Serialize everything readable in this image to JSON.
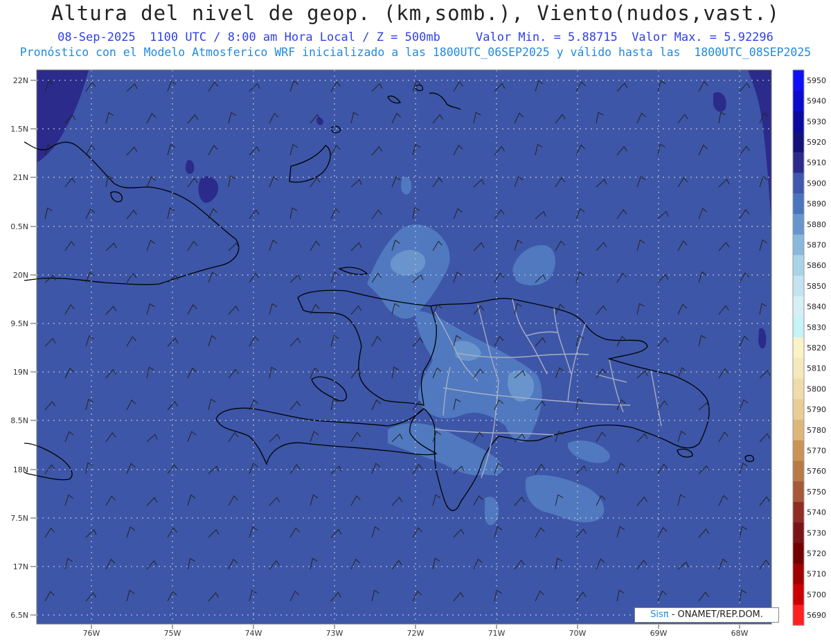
{
  "header": {
    "title": "Altura del nivel de geop. (km,somb.), Viento(nudos,vast.)",
    "date": "08-Sep-2025",
    "time": "1100 UTC / 8:00 am Hora Local / Z = 500mb",
    "valmin": "Valor Min. = 5.88715",
    "valmax": "Valor Max. = 5.92296",
    "model_line": "Pronóstico con el Modelo Atmosferico WRF inicializado a las 1800UTC_06SEP2025 y válido hasta las  1800UTC_08SEP2025"
  },
  "axes": {
    "lat_labels": [
      "22N",
      "1.5N",
      "21N",
      "0.5N",
      "20N",
      "9.5N",
      "19N",
      "8.5N",
      "18N",
      "7.5N",
      "17N",
      "6.5N"
    ],
    "lon_labels": [
      "76W",
      "75W",
      "74W",
      "73W",
      "72W",
      "71W",
      "70W",
      "69W",
      "68W"
    ]
  },
  "colorbar": {
    "labels": [
      "5950",
      "5940",
      "5930",
      "5920",
      "5910",
      "5900",
      "5890",
      "5880",
      "5870",
      "5860",
      "5850",
      "5840",
      "5830",
      "5820",
      "5810",
      "5800",
      "5790",
      "5780",
      "5770",
      "5760",
      "5750",
      "5740",
      "5730",
      "5720",
      "5710",
      "5700",
      "5690"
    ],
    "colors": [
      "#1010f8",
      "#0b0bd0",
      "#0a0aa0",
      "#12127a",
      "#2b2b8c",
      "#3f57ad",
      "#4a74bd",
      "#6696cc",
      "#8ab8dc",
      "#aad3e8",
      "#c3e3f0",
      "#d6eef6",
      "#c6f2f8",
      "#fbf3c8",
      "#f5e8bd",
      "#efdcaa",
      "#e8cd95",
      "#dcb67a",
      "#c99456",
      "#b87a46",
      "#a65a38",
      "#8e2e24",
      "#7a1418",
      "#730000",
      "#a00000",
      "#cc0000",
      "#ff2020"
    ]
  },
  "colors": {
    "base": "#3d56a7",
    "level_5910": "#2b2b8c",
    "level_5890": "#5079bf",
    "level_5880": "#6a95cc"
  },
  "credit": {
    "sis": "Sisπ",
    "org": " - ONAMET/REP.DOM."
  }
}
